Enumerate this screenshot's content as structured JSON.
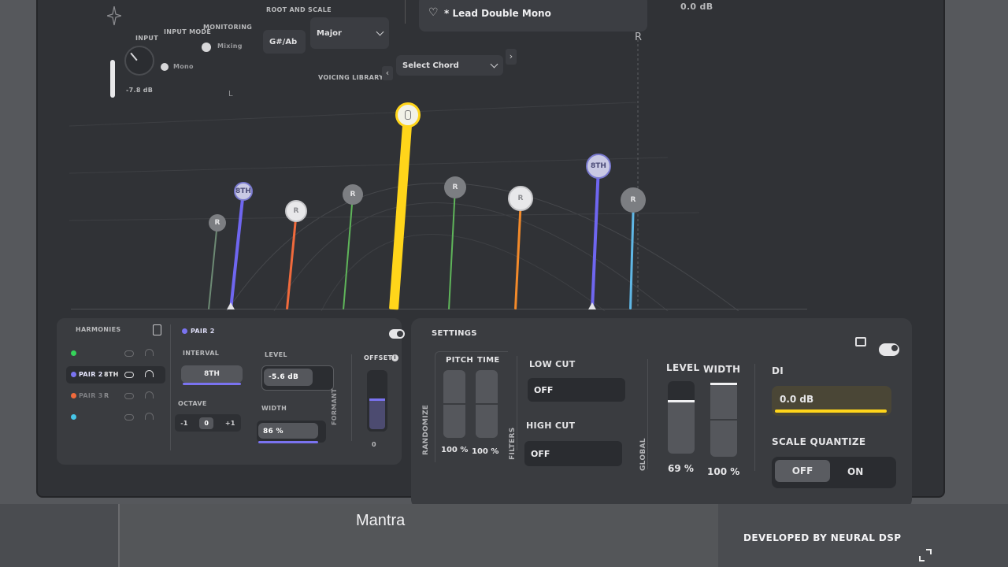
{
  "header": {
    "input_label": "INPUT",
    "input_mode_label": "INPUT MODE",
    "monitoring_label": "MONITORING",
    "root_scale_label": "ROOT AND SCALE",
    "input_value": "-7.8 dB",
    "input_mode_option": "Mono",
    "monitoring_option": "Mixing",
    "root_value": "G#/Ab",
    "scale_value": "Major",
    "preset_name": "* Lead Double Mono",
    "output_value": "0.0 dB",
    "voicing_library_label": "VOICING LIBRARY",
    "voicing_value": "Select Chord"
  },
  "visualizer": {
    "top_marker_r": "R",
    "center_marker_l": "L",
    "voices": [
      {
        "label": "R",
        "color": "#6d8a74",
        "style": "dim"
      },
      {
        "label": "8TH",
        "color": "#6f66f0",
        "style": "oct"
      },
      {
        "label": "R",
        "color": "#f06a3c",
        "style": "bright"
      },
      {
        "label": "R",
        "color": "#5fb55a",
        "style": "dim"
      },
      {
        "label": "",
        "color": "#ffd51a",
        "style": "main"
      },
      {
        "label": "R",
        "color": "#5fb55a",
        "style": "dim"
      },
      {
        "label": "R",
        "color": "#f38a2a",
        "style": "bright"
      },
      {
        "label": "8TH",
        "color": "#6f66f0",
        "style": "oct"
      },
      {
        "label": "R",
        "color": "#5fb7e6",
        "style": "dim"
      }
    ]
  },
  "harmonies": {
    "title": "HARMONIES",
    "pairs": [
      {
        "label": "",
        "dot": "#35d35a",
        "interval": "",
        "active": false
      },
      {
        "label": "PAIR 2",
        "dot": "#7a73f0",
        "interval": "8TH",
        "active": true
      },
      {
        "label": "PAIR 3",
        "dot": "#f06a3c",
        "interval": "R",
        "active": false
      },
      {
        "label": "",
        "dot": "#46c6e8",
        "interval": "",
        "active": false
      }
    ],
    "selected_pair": "PAIR 2",
    "interval_label": "INTERVAL",
    "interval_value": "8TH",
    "octave_label": "OCTAVE",
    "octave_options": [
      "-1",
      "0",
      "+1"
    ],
    "level_label": "LEVEL",
    "level_value": "-5.6 dB",
    "width_label": "WIDTH",
    "width_value": "86 %",
    "offset_label": "OFFSET",
    "offset_value": "0",
    "formant_label": "FORMANT"
  },
  "settings": {
    "title": "SETTINGS",
    "randomize_label": "RANDOMIZE",
    "pitch_label": "PITCH",
    "time_label": "TIME",
    "pitch_value": "100 %",
    "time_value": "100 %",
    "filters_label": "FILTERS",
    "low_cut_label": "LOW CUT",
    "low_cut_value": "OFF",
    "high_cut_label": "HIGH CUT",
    "high_cut_value": "OFF",
    "global_label": "GLOBAL",
    "level_label": "LEVEL",
    "width_label": "WIDTH",
    "level_value": "69 %",
    "width_value": "100 %",
    "di_label": "DI",
    "di_value": "0.0 dB",
    "scale_quantize_label": "SCALE QUANTIZE",
    "sq_off": "OFF",
    "sq_on": "ON"
  },
  "footer": {
    "app_name": "Mantra",
    "developer": "DEVELOPED BY NEURAL DSP"
  },
  "colors": {
    "accent_purple": "#7a73f0",
    "accent_yellow": "#ffd51a",
    "panel": "#3a3c40"
  }
}
